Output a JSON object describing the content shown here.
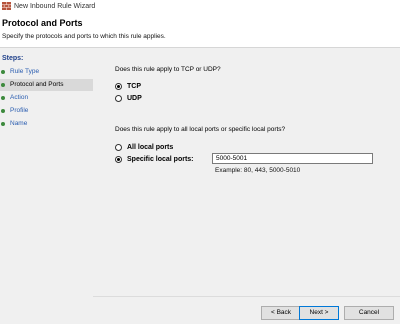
{
  "window": {
    "title": "New Inbound Rule Wizard",
    "icon": "firewall-icon"
  },
  "header": {
    "title": "Protocol and Ports",
    "subtitle": "Specify the protocols and ports to which this rule applies."
  },
  "steps": {
    "label": "Steps:",
    "items": [
      {
        "label": "Rule Type"
      },
      {
        "label": "Protocol and Ports"
      },
      {
        "label": "Action"
      },
      {
        "label": "Profile"
      },
      {
        "label": "Name"
      }
    ],
    "active_index": 1
  },
  "protocol": {
    "question": "Does this rule apply to TCP or UDP?",
    "options": [
      {
        "label": "TCP",
        "selected": true
      },
      {
        "label": "UDP",
        "selected": false
      }
    ]
  },
  "ports": {
    "question": "Does this rule apply to all local ports or specific local ports?",
    "options": [
      {
        "label": "All local ports",
        "selected": false
      },
      {
        "label": "Specific local ports:",
        "selected": true
      }
    ],
    "value": "5000-5001",
    "example": "Example: 80, 443, 5000-5010"
  },
  "buttons": {
    "back": "< Back",
    "next": "Next >",
    "cancel": "Cancel"
  },
  "colors": {
    "step_link": "#2a5db0",
    "steps_heading": "#1e3f8a",
    "step_bullet": "#3d8a3d"
  }
}
